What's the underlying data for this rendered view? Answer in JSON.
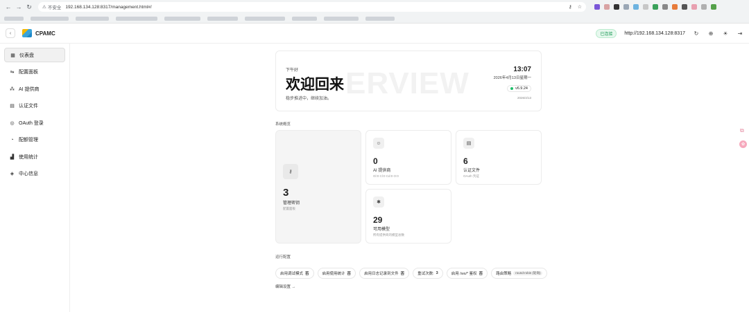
{
  "browser": {
    "security_label": "不安全",
    "url": "192.168.134.128:8317/management.html#/"
  },
  "header": {
    "brand": "CPAMC",
    "status": "已连接",
    "endpoint": "http://192.168.134.128:8317"
  },
  "sidebar": {
    "items": [
      {
        "label": "仪表盘",
        "icon": "dashboard-icon",
        "active": true
      },
      {
        "label": "配置面板",
        "icon": "sliders-icon"
      },
      {
        "label": "AI 提供商",
        "icon": "network-icon"
      },
      {
        "label": "认证文件",
        "icon": "file-icon"
      },
      {
        "label": "OAuth 登录",
        "icon": "shield-icon"
      },
      {
        "label": "配额管理",
        "icon": "gauge-icon"
      },
      {
        "label": "使用统计",
        "icon": "bar-chart-icon"
      },
      {
        "label": "中心信息",
        "icon": "info-icon"
      }
    ]
  },
  "welcome": {
    "greeting": "下午好",
    "title": "欢迎回来",
    "subtitle": "稳步推进中，继续加油。",
    "watermark": "ERVIEW",
    "time": "13:07",
    "date": "2026年4月13日星期一",
    "version": "v6.9.24",
    "date_small": "2026/4/13"
  },
  "overview": {
    "label": "系统概览",
    "cards": {
      "keys": {
        "value": "3",
        "title": "管理密钥",
        "sub": "配置面板"
      },
      "providers": {
        "value": "0",
        "title": "AI 提供商",
        "sub": "Gl:0 Cl:0 Cd:0 O:0"
      },
      "auth": {
        "value": "6",
        "title": "认证文件",
        "sub": "OAuth 凭证"
      },
      "models": {
        "value": "29",
        "title": "可用模型",
        "sub": "所有提供商的模型总数"
      }
    }
  },
  "runtime": {
    "label": "运行配置",
    "chips": [
      {
        "label": "启用调试模式",
        "value": "否"
      },
      {
        "label": "启用使用统计",
        "value": "否"
      },
      {
        "label": "启用日志记录到文件",
        "value": "否"
      },
      {
        "label": "重试次数:",
        "value": "3"
      },
      {
        "label": "启用 /ws/* 鉴权",
        "value": "否"
      },
      {
        "label": "路由策略",
        "value": "round-robin (轮询)"
      }
    ],
    "edit_link": "编辑设置 →"
  }
}
